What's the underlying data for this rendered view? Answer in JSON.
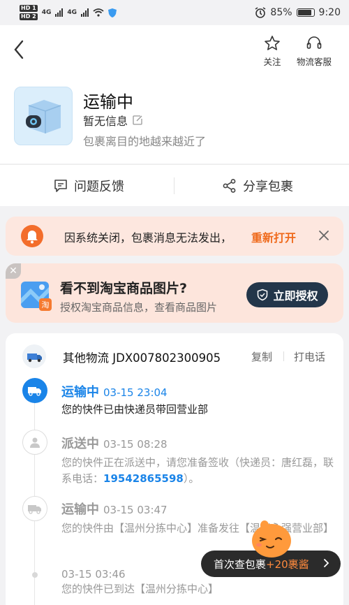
{
  "statusbar": {
    "sim1": "HD 1",
    "sim2": "HD 2",
    "net1": "4G",
    "net2": "4G",
    "battery": "85%",
    "time": "9:20"
  },
  "header": {
    "follow_label": "关注",
    "service_label": "物流客服"
  },
  "status": {
    "title": "运输中",
    "subtitle": "暂无信息",
    "desc": "包裹离目的地越来越近了"
  },
  "actions": {
    "feedback": "问题反馈",
    "share": "分享包裹"
  },
  "notice": {
    "text": "因系统关闭，包裹消息无法发出，",
    "link": "重新打开"
  },
  "promo": {
    "title": "看不到淘宝商品图片?",
    "subtitle": "授权淘宝商品信息，查看商品图片",
    "button": "立即授权",
    "close": "✕",
    "badge": "淘"
  },
  "tracking": {
    "carrier": "其他物流 JDX007802300905",
    "copy": "复制",
    "call": "打电话",
    "events": [
      {
        "status": "运输中",
        "time": "03-15 23:04",
        "desc": "您的快件已由快递员带回营业部"
      },
      {
        "status": "派送中",
        "time": "03-15 08:28",
        "desc_before": "您的快件正在派送中，请您准备签收（快递员：唐红磊，联系电话：",
        "phone": "19542865598",
        "desc_after": "）。"
      },
      {
        "status": "运输中",
        "time": "03-15 03:47",
        "desc": "您的快件由【温州分拣中心】准备发往【温州永强营业部】"
      },
      {
        "status": "",
        "time": "03-15 03:46",
        "desc": "您的快件已到达【温州分拣中心】"
      }
    ]
  },
  "floating": {
    "text": "首次查包裹",
    "highlight": "+20裹酱"
  }
}
